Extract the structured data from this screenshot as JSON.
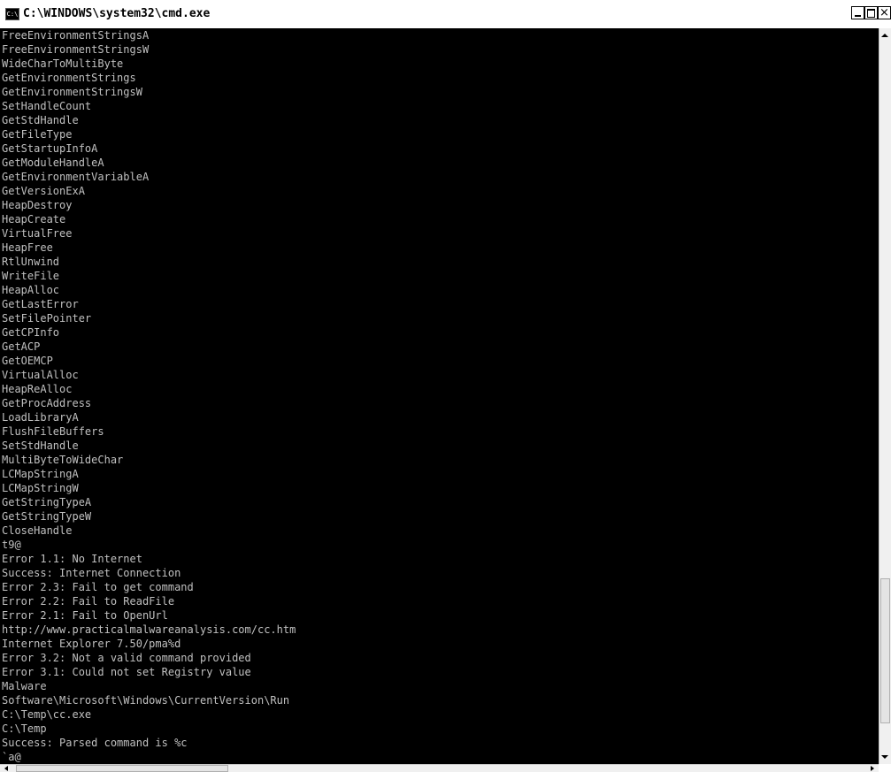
{
  "window": {
    "title": "C:\\WINDOWS\\system32\\cmd.exe",
    "icon": "cmd-icon",
    "controls": {
      "minimize": "minimize-icon",
      "maximize": "maximize-icon",
      "close": "close-icon"
    }
  },
  "console": {
    "background": "#000000",
    "text_color": "#c0c0c0",
    "lines": [
      "FreeEnvironmentStringsA",
      "FreeEnvironmentStringsW",
      "WideCharToMultiByte",
      "GetEnvironmentStrings",
      "GetEnvironmentStringsW",
      "SetHandleCount",
      "GetStdHandle",
      "GetFileType",
      "GetStartupInfoA",
      "GetModuleHandleA",
      "GetEnvironmentVariableA",
      "GetVersionExA",
      "HeapDestroy",
      "HeapCreate",
      "VirtualFree",
      "HeapFree",
      "RtlUnwind",
      "WriteFile",
      "HeapAlloc",
      "GetLastError",
      "SetFilePointer",
      "GetCPInfo",
      "GetACP",
      "GetOEMCP",
      "VirtualAlloc",
      "HeapReAlloc",
      "GetProcAddress",
      "LoadLibraryA",
      "FlushFileBuffers",
      "SetStdHandle",
      "MultiByteToWideChar",
      "LCMapStringA",
      "LCMapStringW",
      "GetStringTypeA",
      "GetStringTypeW",
      "CloseHandle",
      "t9@",
      "Error 1.1: No Internet",
      "Success: Internet Connection",
      "Error 2.3: Fail to get command",
      "Error 2.2: Fail to ReadFile",
      "Error 2.1: Fail to OpenUrl",
      "http://www.practicalmalwareanalysis.com/cc.htm",
      "Internet Explorer 7.50/pma%d",
      "Error 3.2: Not a valid command provided",
      "Error 3.1: Could not set Registry value",
      "Malware",
      "Software\\Microsoft\\Windows\\CurrentVersion\\Run",
      "C:\\Temp\\cc.exe",
      "C:\\Temp",
      "Success: Parsed command is %c",
      "`a@"
    ]
  },
  "scrollbars": {
    "vertical_position": 0.75,
    "horizontal_position": 0.0
  }
}
